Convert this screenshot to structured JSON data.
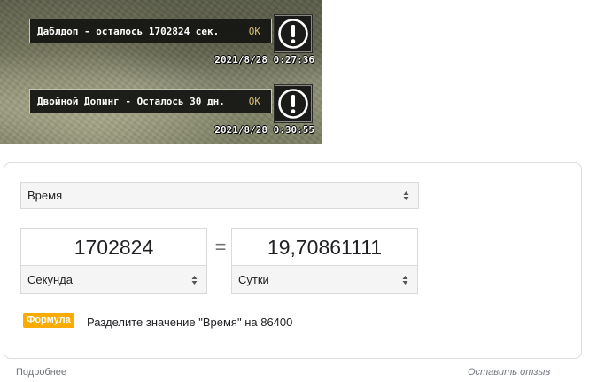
{
  "game": {
    "notifications": [
      {
        "message": "Даблдоп - осталось 1702824 сек.",
        "ok_label": "OK",
        "timestamp": "2021/8/28  0:27:36",
        "icon": "exclamation-circle-icon"
      },
      {
        "message": "Двойной Допинг - Осталось 30 дн.",
        "ok_label": "OK",
        "timestamp": "2021/8/28  0:30:55",
        "icon": "exclamation-circle-icon"
      }
    ]
  },
  "converter": {
    "quantity": "Время",
    "from": {
      "value": "1702824",
      "unit": "Секунда"
    },
    "equals": "=",
    "to": {
      "value": "19,70861111",
      "unit": "Сутки"
    },
    "formula_badge": "Формула",
    "formula_text": "Разделите значение \"Время\" на 86400",
    "colors": {
      "badge": "#f9ab00",
      "border": "#dadada",
      "select_bg": "#f5f5f5"
    }
  },
  "footer": {
    "more_link": "Подробнее",
    "feedback_link": "Оставить отзыв"
  }
}
